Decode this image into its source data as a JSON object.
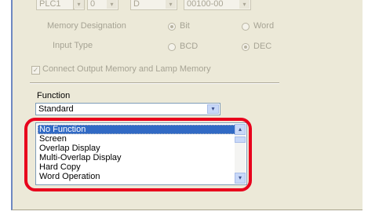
{
  "top_row": {
    "plc_value": "PLC1",
    "field2_value": "0",
    "field3_value": "D",
    "address_value": "00100-00",
    "arrow_glyph": "▾"
  },
  "memory_designation": {
    "label": "Memory Designation",
    "options": [
      "Bit",
      "Word"
    ],
    "selected": "Bit"
  },
  "input_type": {
    "label": "Input Type",
    "options": [
      "BCD",
      "DEC"
    ],
    "selected": "DEC"
  },
  "connect_memory": {
    "label": "Connect Output Memory and Lamp Memory",
    "checked": true,
    "check_glyph": "✓"
  },
  "function": {
    "label": "Function",
    "value": "Standard",
    "arrow_glyph": "▾"
  },
  "function_list": {
    "items": [
      "No Function",
      "Screen",
      "Overlap Display",
      "Multi-Overlap Display",
      "Hard Copy",
      "Word Operation"
    ],
    "selected_index": 0,
    "up_glyph": "▴",
    "down_glyph": "▾"
  },
  "colors": {
    "highlight": "#316ac5",
    "callout": "#e8001c",
    "panel": "#ece9d8"
  },
  "icons": {
    "combo_arrow": "chevron-down-icon",
    "scroll_up": "chevron-up-icon",
    "scroll_down": "chevron-down-icon",
    "check": "check-icon"
  }
}
